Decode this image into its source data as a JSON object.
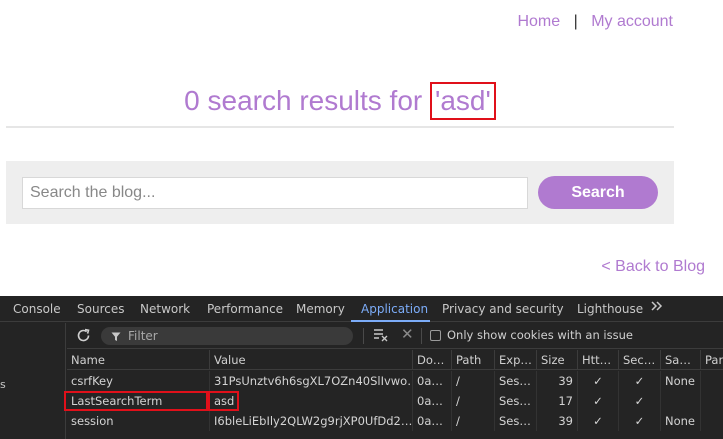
{
  "nav": {
    "home": "Home",
    "separator": "|",
    "account": "My account"
  },
  "heading": {
    "prefix": "0 search results for ",
    "term": "'asd'"
  },
  "search": {
    "placeholder": "Search the blog...",
    "value": "",
    "button": "Search"
  },
  "back_link": "< Back to Blog",
  "devtools": {
    "tabs": [
      "Console",
      "Sources",
      "Network",
      "Performance",
      "Memory",
      "Application",
      "Privacy and security",
      "Lighthouse"
    ],
    "active_tab": "Application",
    "more_icon": "chevron-double-right-icon",
    "left_panel_stub": "s",
    "filter_placeholder": "Filter",
    "only_issue_label": "Only show cookies with an issue",
    "columns": [
      "Name",
      "Value",
      "Do…",
      "Path",
      "Exp…",
      "Size",
      "Htt…",
      "Sec…",
      "Sa…",
      "Par"
    ],
    "rows": [
      {
        "name": "csrfKey",
        "value": "31PsUnztv6h6sgXL7OZn40SlIvwo…",
        "domain": "0a…",
        "path": "/",
        "expires": "Ses…",
        "size": "39",
        "httponly": "✓",
        "secure": "✓",
        "samesite": "None"
      },
      {
        "name": "LastSearchTerm",
        "value": "asd",
        "domain": "0a…",
        "path": "/",
        "expires": "Ses…",
        "size": "17",
        "httponly": "✓",
        "secure": "✓",
        "samesite": ""
      },
      {
        "name": "session",
        "value": "I6bleLiEbIly2QLW2g9rjXP0UfDd2…",
        "domain": "0a…",
        "path": "/",
        "expires": "Ses…",
        "size": "39",
        "httponly": "✓",
        "secure": "✓",
        "samesite": "None"
      }
    ],
    "colors": {
      "accent": "#7cacf8",
      "highlight": "#e0101a",
      "panel_bg": "#242424"
    }
  },
  "colors": {
    "brand": "#b07ad0",
    "panel": "#eeeeee"
  }
}
